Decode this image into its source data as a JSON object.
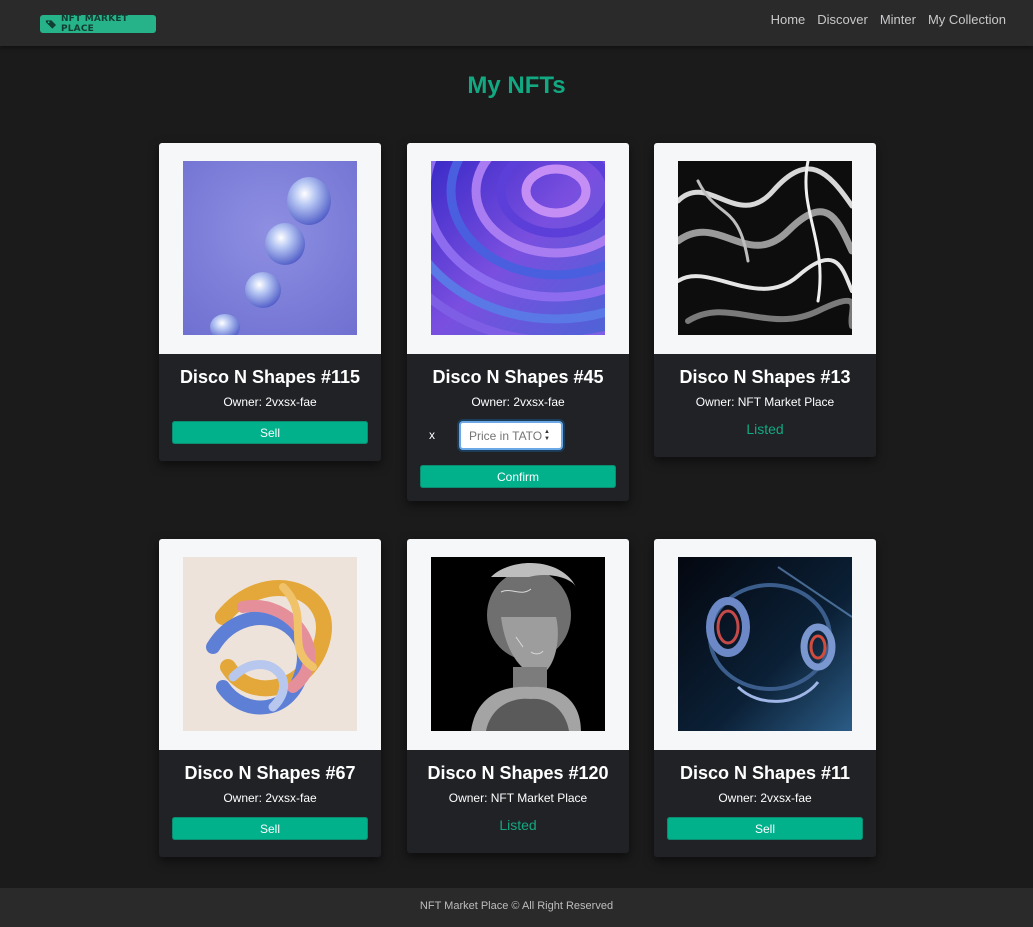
{
  "nav": {
    "logo_text": "NFT MARKET PLACE",
    "links": [
      "Home",
      "Discover",
      "Minter",
      "My Collection"
    ]
  },
  "page": {
    "title": "My NFTs"
  },
  "cards": [
    {
      "title": "Disco N Shapes #115",
      "owner": "Owner: 2vxsx-fae",
      "action": "Sell",
      "art": "blue-glass-drops"
    },
    {
      "title": "Disco N Shapes #45",
      "owner": "Owner: 2vxsx-fae",
      "close": "x",
      "price_placeholder": "Price in TATO",
      "action": "Confirm",
      "art": "purple-waves"
    },
    {
      "title": "Disco N Shapes #13",
      "owner": "Owner: NFT Market Place",
      "status": "Listed",
      "art": "black-liquid-metal"
    },
    {
      "title": "Disco N Shapes #67",
      "owner": "Owner: 2vxsx-fae",
      "action": "Sell",
      "art": "colorful-twist"
    },
    {
      "title": "Disco N Shapes #120",
      "owner": "Owner: NFT Market Place",
      "status": "Listed",
      "art": "marble-bust"
    },
    {
      "title": "Disco N Shapes #11",
      "owner": "Owner: 2vxsx-fae",
      "action": "Sell",
      "art": "glass-rings"
    }
  ],
  "footer": {
    "text": "NFT Market Place © All Right Reserved"
  },
  "colors": {
    "accent": "#12a982",
    "button": "#00b18c",
    "background": "#1b1b1b",
    "navbar": "#2a2a2b"
  }
}
